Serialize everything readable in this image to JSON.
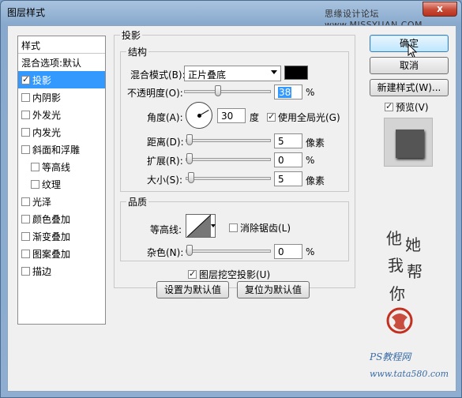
{
  "window": {
    "title": "图层样式",
    "watermark_top": "思缘设计论坛 www.MISSYUAN.COM",
    "close_glyph": "x"
  },
  "styles_panel": {
    "header": "样式",
    "blend_options": "混合选项:默认",
    "items": [
      {
        "label": "投影",
        "checked": true,
        "selected": true,
        "sub": false
      },
      {
        "label": "内阴影",
        "checked": false,
        "selected": false,
        "sub": false
      },
      {
        "label": "外发光",
        "checked": false,
        "selected": false,
        "sub": false
      },
      {
        "label": "内发光",
        "checked": false,
        "selected": false,
        "sub": false
      },
      {
        "label": "斜面和浮雕",
        "checked": false,
        "selected": false,
        "sub": false
      },
      {
        "label": "等高线",
        "checked": false,
        "selected": false,
        "sub": true
      },
      {
        "label": "纹理",
        "checked": false,
        "selected": false,
        "sub": true
      },
      {
        "label": "光泽",
        "checked": false,
        "selected": false,
        "sub": false
      },
      {
        "label": "颜色叠加",
        "checked": false,
        "selected": false,
        "sub": false
      },
      {
        "label": "渐变叠加",
        "checked": false,
        "selected": false,
        "sub": false
      },
      {
        "label": "图案叠加",
        "checked": false,
        "selected": false,
        "sub": false
      },
      {
        "label": "描边",
        "checked": false,
        "selected": false,
        "sub": false
      }
    ]
  },
  "drop_shadow": {
    "title": "投影",
    "structure": {
      "title": "结构",
      "blend_mode_label": "混合模式(B):",
      "blend_mode_value": "正片叠底",
      "shadow_color": "#000000",
      "opacity_label": "不透明度(O):",
      "opacity_value": "38",
      "opacity_unit": "%",
      "opacity_fraction": 0.38,
      "angle_label": "角度(A):",
      "angle_value": "30",
      "angle_unit": "度",
      "global_light_label": "使用全局光(G)",
      "global_light_checked": true,
      "distance_label": "距离(D):",
      "distance_value": "5",
      "distance_unit": "像素",
      "spread_label": "扩展(R):",
      "spread_value": "0",
      "spread_unit": "%",
      "size_label": "大小(S):",
      "size_value": "5",
      "size_unit": "像素"
    },
    "quality": {
      "title": "品质",
      "contour_label": "等高线:",
      "antialias_label": "消除锯齿(L)",
      "antialias_checked": false,
      "noise_label": "杂色(N):",
      "noise_value": "0",
      "noise_unit": "%"
    },
    "knockout_label": "图层挖空投影(U)",
    "knockout_checked": true,
    "make_default": "设置为默认值",
    "reset_default": "复位为默认值"
  },
  "actions": {
    "ok": "确定",
    "cancel": "取消",
    "new_style": "新建样式(W)...",
    "preview_label": "预览(V)",
    "preview_checked": true
  },
  "watermark": {
    "calligraphy": [
      "他",
      "她",
      "我",
      "帮",
      "你"
    ],
    "site_name": "PS教程网",
    "site_url": "www.tata580.com"
  }
}
